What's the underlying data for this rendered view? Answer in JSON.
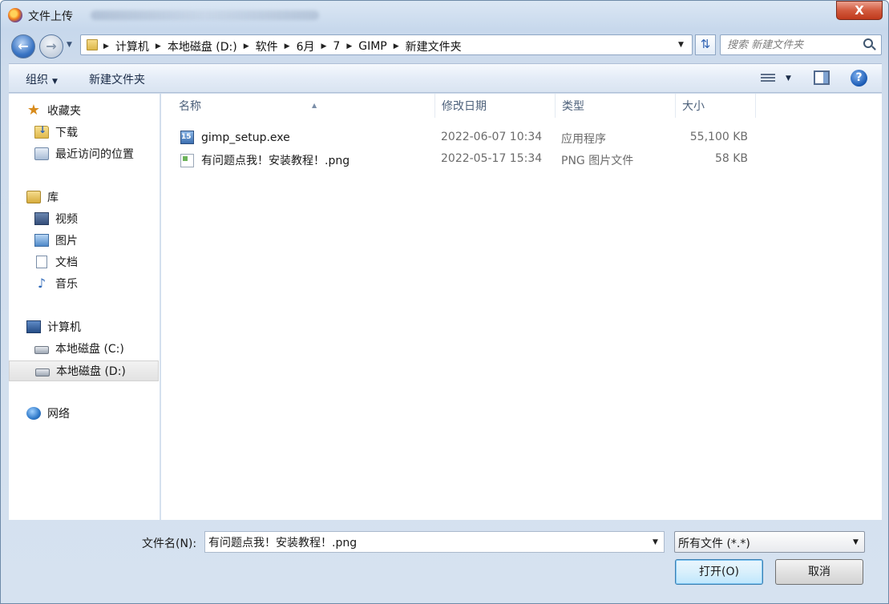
{
  "window": {
    "title": "文件上传",
    "close_label": "X"
  },
  "address": {
    "crumbs": [
      "计算机",
      "本地磁盘 (D:)",
      "软件",
      "6月",
      "7",
      "GIMP",
      "新建文件夹"
    ]
  },
  "search": {
    "placeholder": "搜索 新建文件夹"
  },
  "toolbar": {
    "organize_label": "组织",
    "new_folder_label": "新建文件夹"
  },
  "sidebar": {
    "items": [
      {
        "label": "收藏夹",
        "icon": "star-icon"
      },
      {
        "label": "下载",
        "icon": "downloads-folder-icon"
      },
      {
        "label": "最近访问的位置",
        "icon": "recent-places-icon"
      },
      {
        "label": "库",
        "icon": "library-icon"
      },
      {
        "label": "视频",
        "icon": "video-library-icon"
      },
      {
        "label": "图片",
        "icon": "pictures-library-icon"
      },
      {
        "label": "文档",
        "icon": "documents-library-icon"
      },
      {
        "label": "音乐",
        "icon": "music-library-icon"
      },
      {
        "label": "计算机",
        "icon": "computer-icon"
      },
      {
        "label": "本地磁盘 (C:)",
        "icon": "drive-c-icon"
      },
      {
        "label": "本地磁盘 (D:)",
        "icon": "drive-d-icon",
        "selected": true
      },
      {
        "label": "网络",
        "icon": "network-icon"
      }
    ]
  },
  "columns": {
    "name": "名称",
    "modified": "修改日期",
    "type": "类型",
    "size": "大小"
  },
  "files": [
    {
      "name": "gimp_setup.exe",
      "modified": "2022-06-07 10:34",
      "type": "应用程序",
      "size": "55,100 KB",
      "icon": "exe-icon"
    },
    {
      "name": "有问题点我！安装教程！.png",
      "modified": "2022-05-17 15:34",
      "type": "PNG 图片文件",
      "size": "58 KB",
      "icon": "png-icon"
    }
  ],
  "footer": {
    "filename_label": "文件名(N):",
    "filename_value": "有问题点我！安装教程！.png",
    "filter_value": "所有文件 (*.*)",
    "open_label": "打开(O)",
    "cancel_label": "取消"
  }
}
